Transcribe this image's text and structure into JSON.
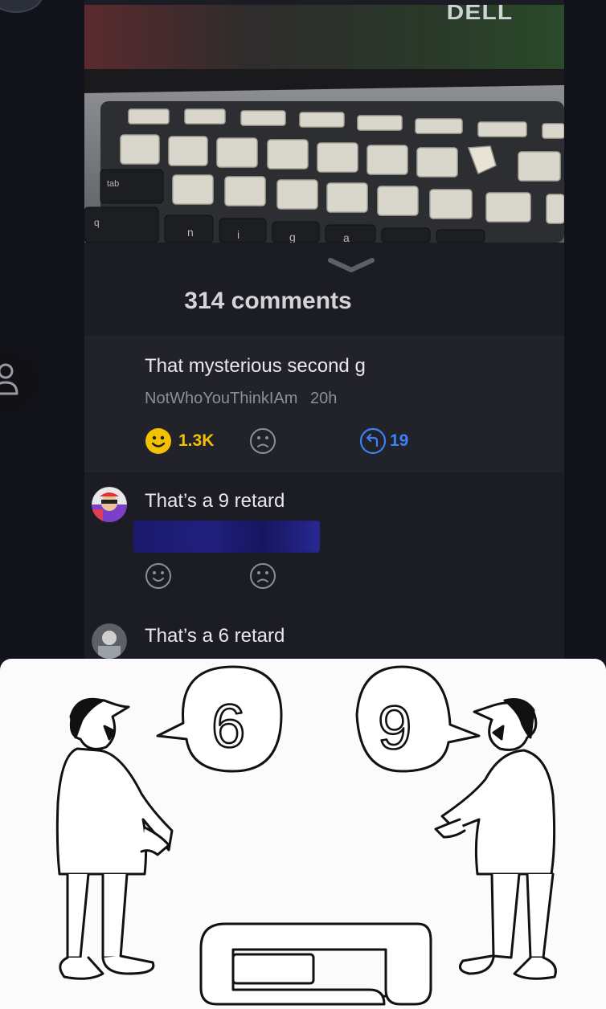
{
  "post": {
    "brand_label": "DELL",
    "comment_count_label": "314 comments"
  },
  "comments": [
    {
      "text": "That mysterious second g",
      "author": "NotWhoYouThinkIAm",
      "time": "20h",
      "likes": "1.3K",
      "replies": "19"
    },
    {
      "text": "That’s a 9 retard"
    },
    {
      "text": "That’s a 6 retard"
    }
  ],
  "keyboard_keys": {
    "tab": "tab",
    "q": "q",
    "n": "n",
    "i": "i",
    "g": "g",
    "a": "a"
  },
  "cartoon": {
    "left_bubble": "6",
    "right_bubble": "9"
  },
  "colors": {
    "accent_like": "#f2c200",
    "accent_reply": "#3b82f6",
    "background": "#1c1c24",
    "card": "#22222b"
  },
  "icons": [
    "user-icon",
    "smile-icon",
    "frown-icon",
    "reply-icon",
    "chevron-down-icon"
  ]
}
